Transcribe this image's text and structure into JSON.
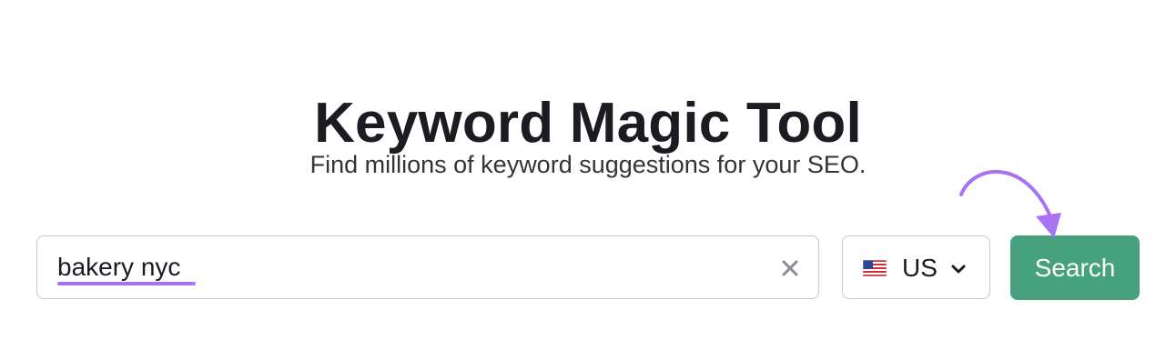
{
  "page": {
    "title": "Keyword Magic Tool",
    "subtitle": "Find millions of keyword suggestions for your SEO."
  },
  "search": {
    "value": "bakery nyc",
    "clear_icon": "close-icon"
  },
  "database": {
    "flag_icon": "us-flag-icon",
    "label": "US",
    "dropdown_icon": "chevron-down-icon"
  },
  "search_button": {
    "label": "Search"
  },
  "colors": {
    "accent": "#45a17e",
    "highlight": "#a972f2",
    "text": "#1b1c22",
    "border": "#c7c8cd"
  }
}
